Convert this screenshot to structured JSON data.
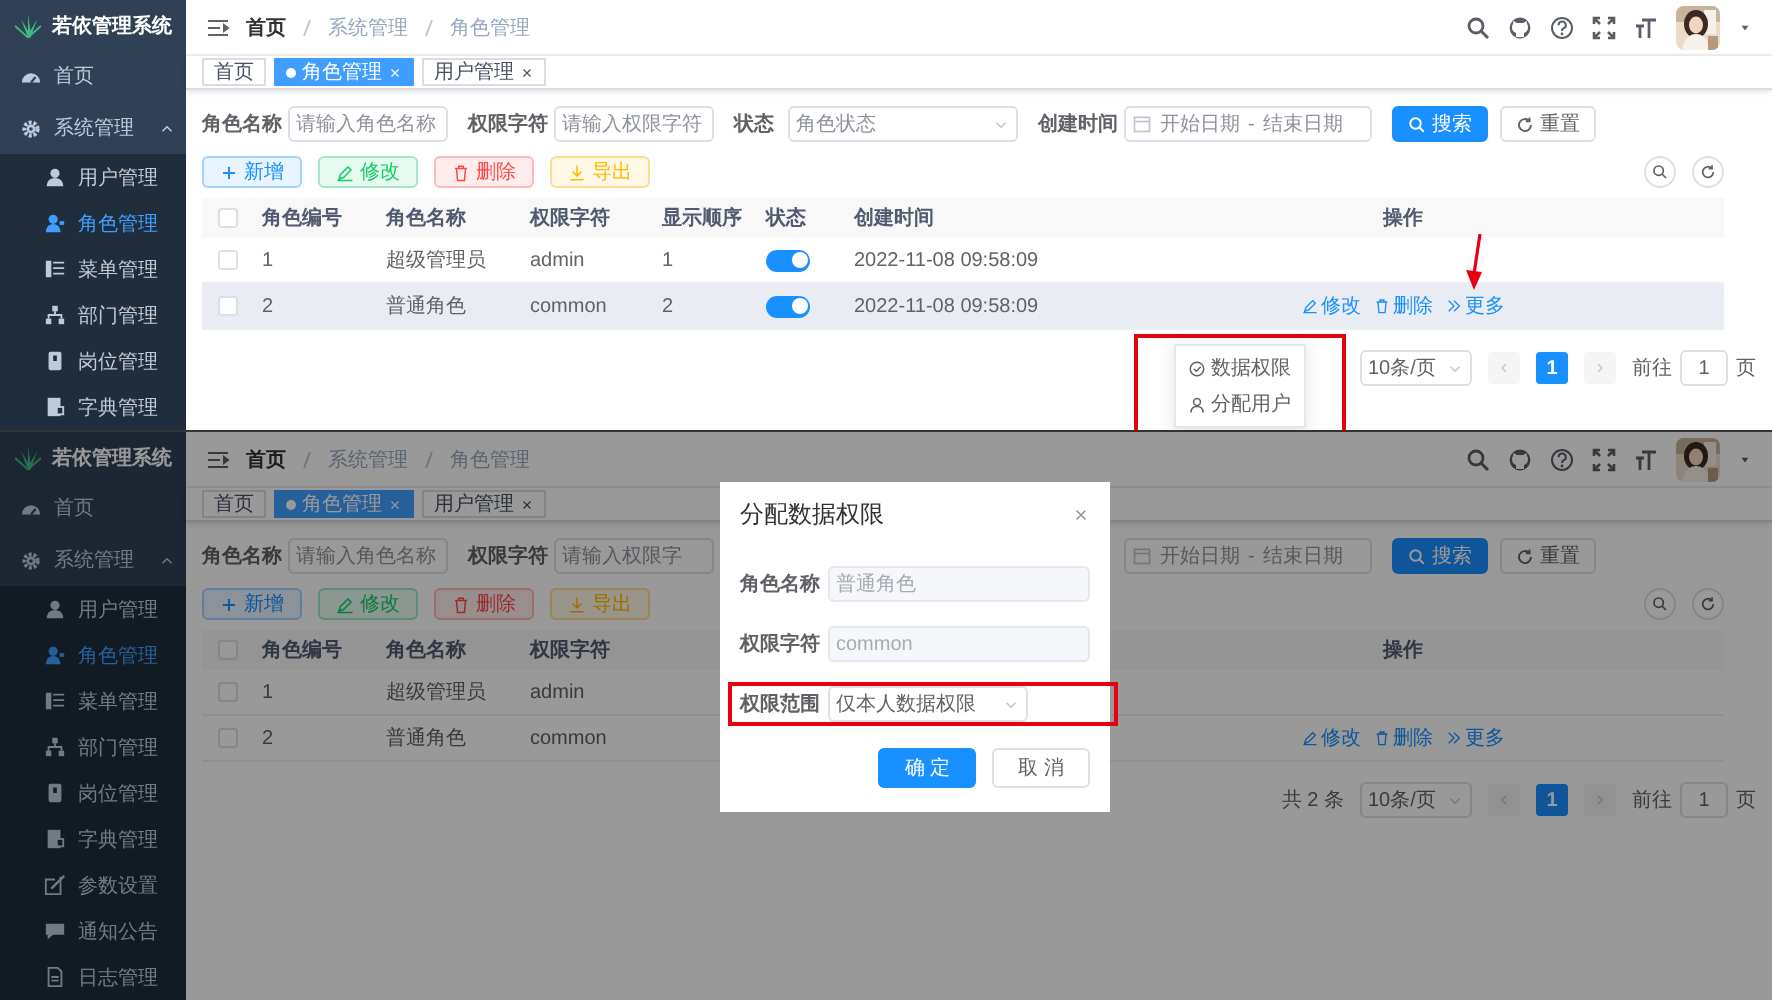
{
  "screens": [
    {
      "sidebar": {
        "title": "若依管理系统",
        "items": [
          {
            "label": "首页",
            "selected": false
          },
          {
            "label": "系统管理",
            "selected": false,
            "expanded": true,
            "children": [
              {
                "label": "用户管理",
                "selected": false
              },
              {
                "label": "角色管理",
                "selected": true
              },
              {
                "label": "菜单管理",
                "selected": false
              },
              {
                "label": "部门管理",
                "selected": false
              },
              {
                "label": "岗位管理",
                "selected": false
              },
              {
                "label": "字典管理",
                "selected": false
              }
            ]
          }
        ]
      },
      "breadcrumb": [
        "首页",
        "系统管理",
        "角色管理"
      ],
      "tags": [
        {
          "label": "首页",
          "selected": false,
          "closable": false
        },
        {
          "label": "角色管理",
          "selected": true,
          "closable": true
        },
        {
          "label": "用户管理",
          "selected": false,
          "closable": true
        }
      ],
      "search": {
        "fields": [
          {
            "kind": "input",
            "label": "角色名称",
            "placeholder": "请输入角色名称"
          },
          {
            "kind": "input",
            "label": "权限字符",
            "placeholder": "请输入权限字符"
          },
          {
            "kind": "select",
            "label": "状态",
            "placeholder": "角色状态"
          },
          {
            "kind": "date",
            "label": "创建时间",
            "start_placeholder": "开始日期",
            "separator": "-",
            "end_placeholder": "结束日期"
          }
        ],
        "buttons": [
          {
            "kind": "primary",
            "label": "搜索"
          },
          {
            "kind": "default",
            "label": "重置"
          }
        ]
      },
      "toolbar": [
        {
          "kind": "primary",
          "label": "新增"
        },
        {
          "kind": "success",
          "label": "修改"
        },
        {
          "kind": "danger",
          "label": "删除"
        },
        {
          "kind": "warning",
          "label": "导出"
        }
      ],
      "table": {
        "columns": [
          {
            "kind": "select",
            "checked": false
          },
          {
            "kind": "id",
            "label": "角色编号"
          },
          {
            "kind": "name",
            "label": "角色名称"
          },
          {
            "kind": "key",
            "label": "权限字符"
          },
          {
            "kind": "sort",
            "label": "显示顺序"
          },
          {
            "kind": "status",
            "label": "状态"
          },
          {
            "kind": "created",
            "label": "创建时间"
          },
          {
            "kind": "actions",
            "label": "操作"
          }
        ],
        "rows": [
          {
            "checked": false,
            "highlighted": false,
            "id": "1",
            "name": "超级管理员",
            "key": "admin",
            "sort": "1",
            "status_on": true,
            "created": "2022-11-08 09:58:09",
            "actions": []
          },
          {
            "checked": false,
            "highlighted": true,
            "id": "2",
            "name": "普通角色",
            "key": "common",
            "sort": "2",
            "status_on": true,
            "created": "2022-11-08 09:58:09",
            "actions": [
              {
                "kind": "edit",
                "label": "修改",
                "pointed_at": false
              },
              {
                "kind": "delete",
                "label": "删除",
                "pointed_at": false
              },
              {
                "kind": "more",
                "label": "更多",
                "pointed_at": true
              }
            ]
          }
        ]
      },
      "dropdown": {
        "highlighted": true,
        "items": [
          {
            "kind": "data-scope",
            "label": "数据权限"
          },
          {
            "kind": "user",
            "label": "分配用户"
          }
        ]
      },
      "pagination": {
        "page_size": "10条/页",
        "pages": [
          {
            "label": "1",
            "selected": true
          }
        ],
        "goto_label": "前往",
        "goto_value": "1",
        "page_unit": "页"
      }
    },
    {
      "sidebar": {
        "title": "若依管理系统",
        "items": [
          {
            "label": "首页",
            "selected": false
          },
          {
            "label": "系统管理",
            "selected": false,
            "expanded": true,
            "children": [
              {
                "label": "用户管理",
                "selected": false
              },
              {
                "label": "角色管理",
                "selected": true
              },
              {
                "label": "菜单管理",
                "selected": false
              },
              {
                "label": "部门管理",
                "selected": false
              },
              {
                "label": "岗位管理",
                "selected": false
              },
              {
                "label": "字典管理",
                "selected": false
              },
              {
                "label": "参数设置",
                "selected": false
              },
              {
                "label": "通知公告",
                "selected": false
              },
              {
                "label": "日志管理",
                "selected": false,
                "expanded": false
              }
            ]
          }
        ]
      },
      "breadcrumb": [
        "首页",
        "系统管理",
        "角色管理"
      ],
      "tags": [
        {
          "label": "首页",
          "selected": false,
          "closable": false
        },
        {
          "label": "角色管理",
          "selected": true,
          "closable": true
        },
        {
          "label": "用户管理",
          "selected": false,
          "closable": true
        }
      ],
      "search": {
        "fields": [
          {
            "kind": "input",
            "label": "角色名称",
            "placeholder": "请输入角色名称"
          },
          {
            "kind": "input",
            "label": "权限字符",
            "placeholder": "请输入权限字"
          },
          {
            "kind": "select"
          },
          {
            "kind": "date",
            "start_placeholder": "开始日期",
            "separator": "-",
            "end_placeholder": "结束日期"
          }
        ],
        "buttons": [
          {
            "kind": "primary",
            "label": "搜索"
          },
          {
            "kind": "default",
            "label": "重置"
          }
        ]
      },
      "toolbar": [
        {
          "kind": "primary",
          "label": "新增"
        },
        {
          "kind": "success",
          "label": "修改"
        },
        {
          "kind": "danger",
          "label": "删除"
        },
        {
          "kind": "warning",
          "label": "导出"
        }
      ],
      "table": {
        "columns": [
          {
            "kind": "select",
            "checked": false
          },
          {
            "kind": "id",
            "label": "角色编号"
          },
          {
            "kind": "name",
            "label": "角色名称"
          },
          {
            "kind": "key",
            "label": "权限字符"
          },
          {
            "kind": "actions",
            "label": "操作"
          }
        ],
        "rows": [
          {
            "checked": false,
            "highlighted": false,
            "id": "1",
            "name": "超级管理员",
            "key": "admin",
            "actions": []
          },
          {
            "checked": false,
            "highlighted": false,
            "id": "2",
            "name": "普通角色",
            "key": "common",
            "actions": [
              {
                "kind": "edit",
                "label": "修改",
                "pointed_at": false
              },
              {
                "kind": "delete",
                "label": "删除",
                "pointed_at": false
              },
              {
                "kind": "more",
                "label": "更多",
                "pointed_at": false
              }
            ]
          }
        ]
      },
      "pagination": {
        "total": "共 2 条",
        "page_size": "10条/页",
        "pages": [
          {
            "label": "1",
            "selected": true
          }
        ],
        "goto_label": "前往",
        "goto_value": "1",
        "page_unit": "页"
      },
      "modal": {
        "title": "分配数据权限",
        "fields": [
          {
            "kind": "input",
            "label": "角色名称",
            "value": "普通角色",
            "disabled": true,
            "highlighted": false
          },
          {
            "kind": "input",
            "label": "权限字符",
            "value": "common",
            "disabled": true,
            "highlighted": false
          },
          {
            "kind": "select",
            "label": "权限范围",
            "value": "仅本人数据权限",
            "disabled": false,
            "highlighted": true
          }
        ],
        "buttons": [
          {
            "kind": "primary",
            "label": "确 定"
          },
          {
            "kind": "default",
            "label": "取 消"
          }
        ]
      }
    }
  ]
}
